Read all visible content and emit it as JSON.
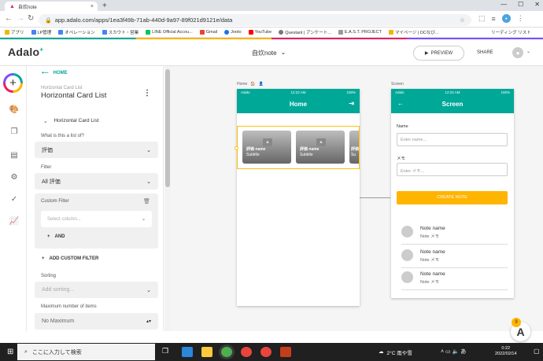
{
  "browser": {
    "tab_title": "自炊note",
    "url": "app.adalo.com/apps/1ea3f49b-71ab-440d-9a97-89f021d9121e/data",
    "bookmarks": [
      "アプリ",
      "LP管理",
      "オペレーション",
      "スカウト・営業",
      "LINE Official Accou...",
      "Gmail",
      "Jooto",
      "YouTube",
      "Questant | アンケート...",
      "E.A.S.T. PROJECT",
      "マイページ | DCなび..."
    ],
    "reading_list": "リーディング リスト"
  },
  "app_header": {
    "logo": "Adalo",
    "app_name": "自炊note",
    "preview_label": "PREVIEW",
    "share_label": "SHARE"
  },
  "panel": {
    "back_label": "HOME",
    "component_type": "Horizontal Card List",
    "component_name": "Horizontal Card List",
    "section_title": "Horizontal Card List",
    "list_of_label": "What is this a list of?",
    "list_of_value": "評価",
    "filter_label": "Filter",
    "filter_value": "All 評価",
    "custom_filter_label": "Custom Filter",
    "select_column_placeholder": "Select column...",
    "and_label": "AND",
    "add_custom_filter_label": "ADD CUSTOM FILTER",
    "sorting_label": "Sorting",
    "sorting_placeholder": "Add sorting...",
    "max_items_label": "Maximum number of items",
    "max_items_value": "No Maximum"
  },
  "canvas": {
    "home_screen": {
      "label": "Home",
      "status_left": "Adalo",
      "status_time": "12:22 AM",
      "status_right": "100%",
      "title": "Home",
      "cards": [
        {
          "name": "評価 name",
          "subtitle": "Subtitle"
        },
        {
          "name": "評価 name",
          "subtitle": "Subtitle"
        },
        {
          "name": "評価",
          "subtitle": "Su"
        }
      ]
    },
    "screen": {
      "label": "Screen",
      "status_left": "Adalo",
      "status_time": "12:22 AM",
      "status_right": "100%",
      "title": "Screen",
      "name_label": "Name",
      "name_placeholder": "Enter name...",
      "memo_label": "メモ",
      "memo_placeholder": "Enter メモ...",
      "create_button": "CREATE NOTE",
      "notes": [
        {
          "name": "Note name",
          "memo": "Note メモ"
        },
        {
          "name": "Note name",
          "memo": "Note メモ"
        },
        {
          "name": "Note name",
          "memo": "Note メモ"
        }
      ]
    },
    "help_badge": "9"
  },
  "taskbar": {
    "search_placeholder": "ここに入力して検索",
    "weather": "2°C 雨や雪",
    "time": "0:22",
    "date": "2022/02/14"
  },
  "colors": {
    "accent": "#00a898",
    "button": "#ffb400"
  }
}
